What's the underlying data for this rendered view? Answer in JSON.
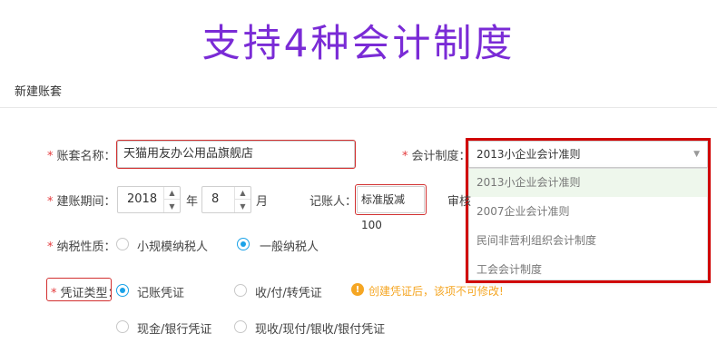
{
  "banner": {
    "title": "支持4种会计制度"
  },
  "page": {
    "header": "新建账套"
  },
  "form": {
    "account_name": {
      "label": "账套名称：",
      "value": "天猫用友办公用品旗舰店"
    },
    "accounting_system": {
      "label": "会计制度：",
      "selected": "2013小企业会计准则",
      "options": [
        "2013小企业会计准则",
        "2007企业会计准则",
        "民间非营利组织会计制度",
        "工会会计制度"
      ]
    },
    "period": {
      "label": "建账期间：",
      "year": "2018",
      "year_unit": "年",
      "month": "8",
      "month_unit": "月"
    },
    "bookkeeper": {
      "label": "记账人：",
      "value": "标准版减100"
    },
    "auditor": {
      "label_partial": "审核"
    },
    "tax": {
      "label": "纳税性质：",
      "options": [
        "小规模纳税人",
        "一般纳税人"
      ],
      "selected": "一般纳税人"
    },
    "voucher": {
      "label": "凭证类型：",
      "options": [
        "记账凭证",
        "收/付/转凭证",
        "现金/银行凭证",
        "现收/现付/银收/银付凭证"
      ],
      "selected": "记账凭证",
      "warning": "创建凭证后，该项不可修改!"
    }
  },
  "colors": {
    "accent": "#1aa2e8",
    "banner": "#7a2bd6",
    "highlight": "#d00000",
    "required": "#e4393c",
    "warning": "#f5a623"
  }
}
